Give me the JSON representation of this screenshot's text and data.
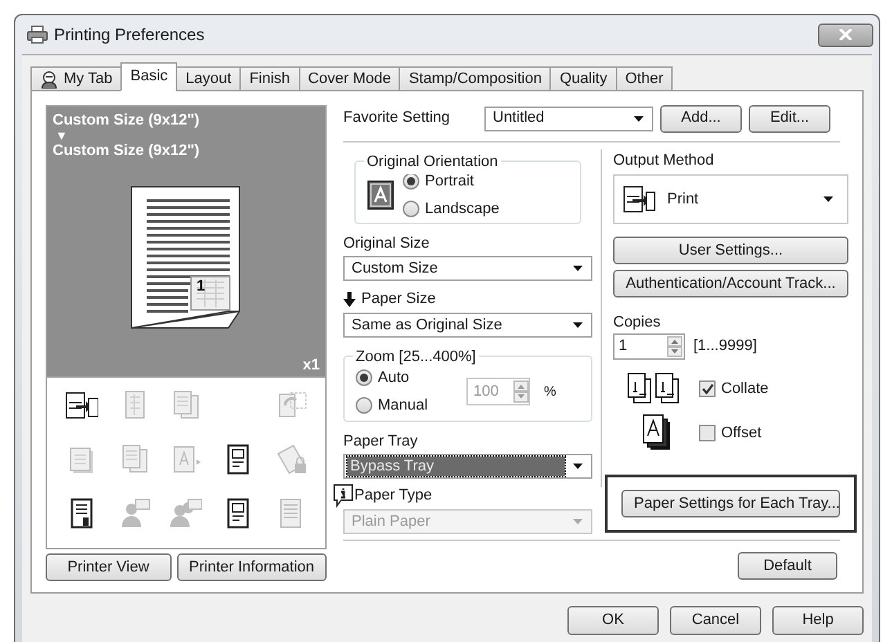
{
  "window": {
    "title": "Printing Preferences"
  },
  "tabs": [
    {
      "label": "My Tab",
      "selected": false,
      "kind": "icon"
    },
    {
      "label": "Basic",
      "selected": true,
      "kind": "text"
    },
    {
      "label": "Layout",
      "selected": false,
      "kind": "text"
    },
    {
      "label": "Finish",
      "selected": false,
      "kind": "text"
    },
    {
      "label": "Cover Mode",
      "selected": false,
      "kind": "text"
    },
    {
      "label": "Stamp/Composition",
      "selected": false,
      "kind": "text"
    },
    {
      "label": "Quality",
      "selected": false,
      "kind": "text"
    },
    {
      "label": "Other",
      "selected": false,
      "kind": "text"
    }
  ],
  "preview": {
    "original": "Custom Size (9x12\")",
    "arrow": "▼",
    "output": "Custom Size (9x12\")",
    "page_number": "1",
    "count": "x1"
  },
  "function_icons": [
    {
      "kind": "output",
      "enabled": true
    },
    {
      "kind": "grid",
      "enabled": false
    },
    {
      "kind": "pages",
      "enabled": false
    },
    {
      "kind": "blank"
    },
    {
      "kind": "rotate",
      "enabled": false
    },
    {
      "kind": "stack",
      "enabled": false
    },
    {
      "kind": "pages",
      "enabled": false
    },
    {
      "kind": "text",
      "enabled": false
    },
    {
      "kind": "form",
      "enabled": true
    },
    {
      "kind": "lock",
      "enabled": false
    },
    {
      "kind": "report",
      "enabled": true
    },
    {
      "kind": "person",
      "enabled": false
    },
    {
      "kind": "people",
      "enabled": false
    },
    {
      "kind": "form",
      "enabled": true
    },
    {
      "kind": "band",
      "enabled": false
    }
  ],
  "printer_buttons": [
    "Printer View",
    "Printer Information"
  ],
  "favorite": {
    "label": "Favorite Setting",
    "value": "Untitled",
    "buttons": [
      "Add...",
      "Edit..."
    ]
  },
  "orientation": {
    "title": "Original Orientation",
    "options": [
      {
        "label": "Portrait",
        "selected": true
      },
      {
        "label": "Landscape",
        "selected": false
      }
    ]
  },
  "original_size": {
    "label": "Original Size",
    "value": "Custom Size"
  },
  "paper_size": {
    "label": "Paper Size",
    "value": "Same as Original Size"
  },
  "zoom": {
    "title": "Zoom [25...400%]",
    "options": [
      {
        "label": "Auto",
        "selected": true
      },
      {
        "label": "Manual",
        "selected": false
      }
    ],
    "value": "100",
    "unit": "%",
    "disabled": true
  },
  "paper_tray": {
    "label": "Paper Tray",
    "value": "Bypass Tray",
    "focused": true
  },
  "paper_type": {
    "label": "Paper Type",
    "value": "Plain Paper",
    "disabled": true
  },
  "output_method": {
    "label": "Output Method",
    "value": "Print"
  },
  "side_buttons": [
    "User Settings...",
    "Authentication/Account Track..."
  ],
  "copies": {
    "label": "Copies",
    "value": "1",
    "range": "[1...9999]"
  },
  "checkboxes": [
    {
      "label": "Collate",
      "checked": true,
      "kind": "collate"
    },
    {
      "label": "Offset",
      "checked": false,
      "kind": "offset"
    }
  ],
  "paper_settings_button": "Paper Settings for Each Tray...",
  "default_button": "Default",
  "dialog_buttons": [
    "OK",
    "Cancel",
    "Help"
  ]
}
